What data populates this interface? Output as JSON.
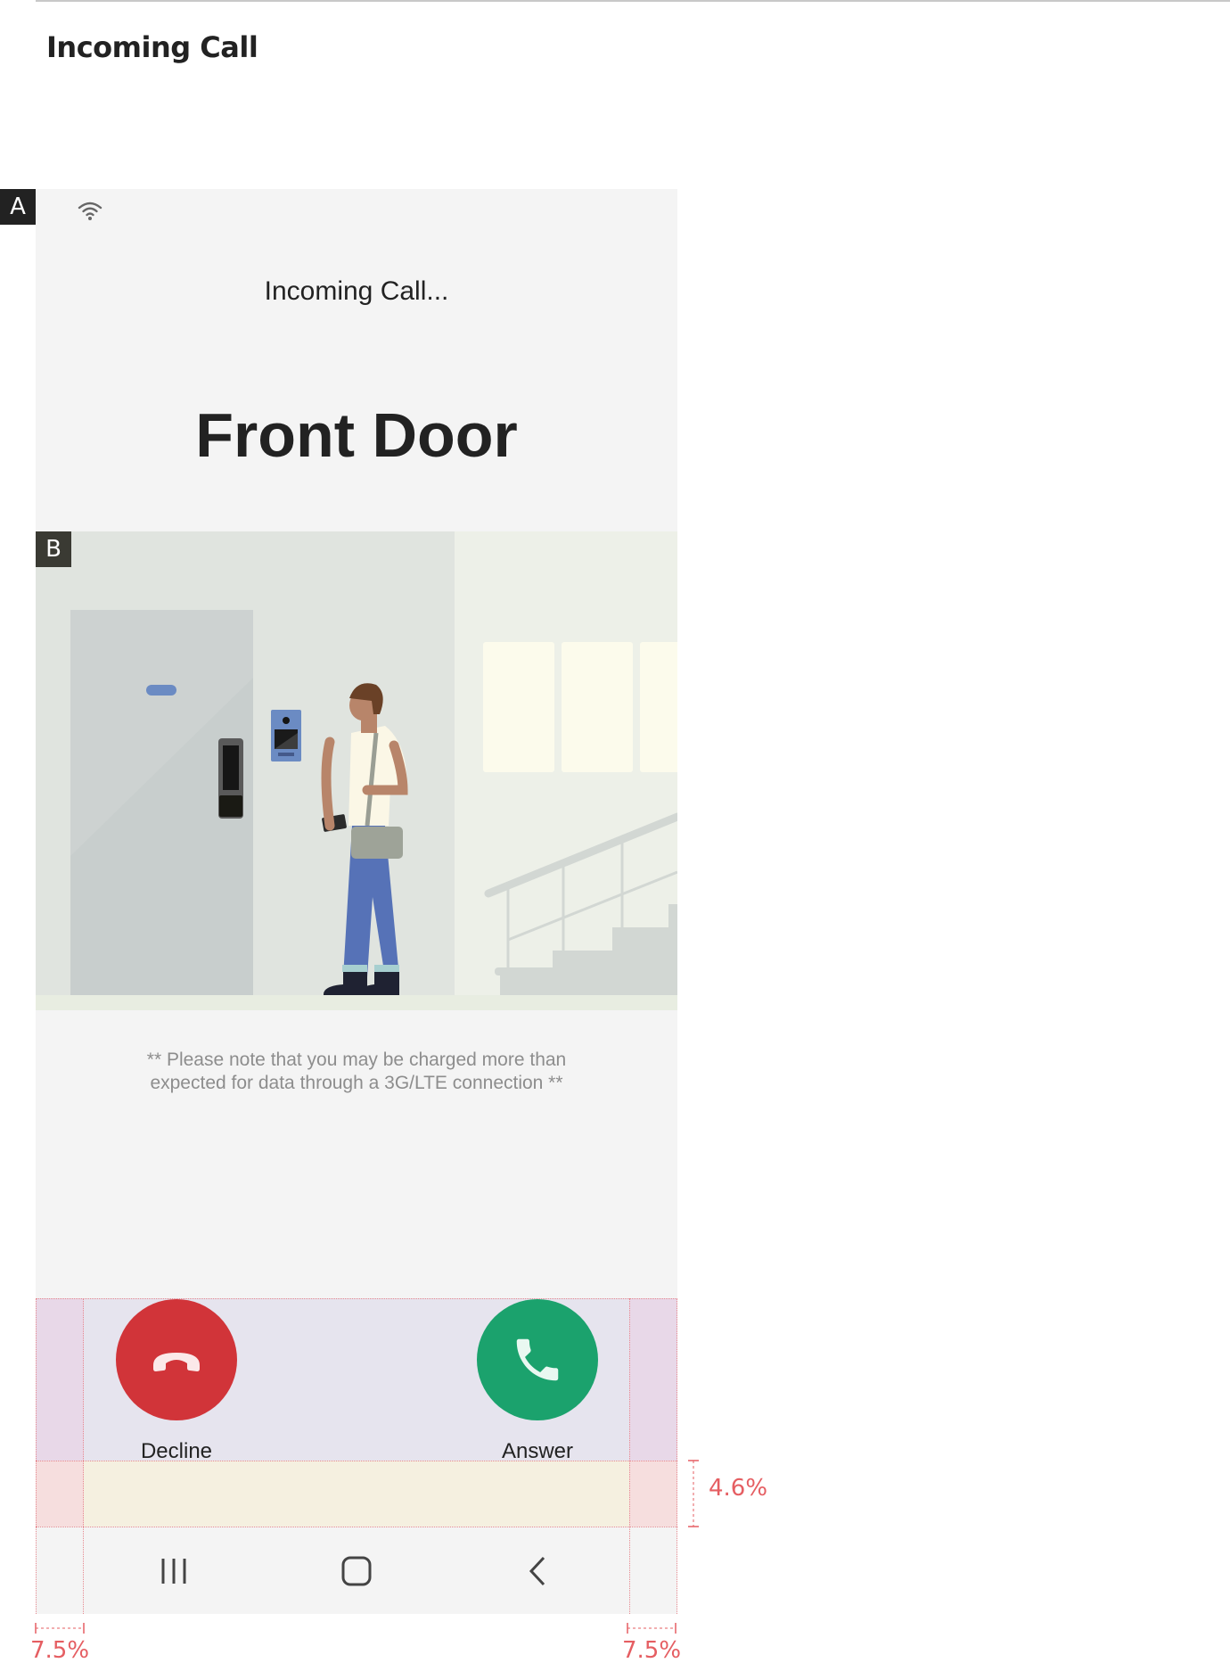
{
  "page": {
    "heading": "Incoming Call"
  },
  "tags": {
    "a": "A",
    "b": "B"
  },
  "call": {
    "status": "Incoming Call...",
    "caller": "Front Door",
    "notice_line1": "** Please note that you may be charged more than",
    "notice_line2": "expected for data through a 3G/LTE connection **"
  },
  "actions": {
    "decline_label": "Decline",
    "answer_label": "Answer"
  },
  "colors": {
    "decline": "#d13439",
    "answer": "#1ba26d",
    "guide": "#e55e62"
  },
  "icons": {
    "status": "wifi-icon",
    "decline": "phone-hangup-icon",
    "answer": "phone-icon",
    "nav_recents": "recents-icon",
    "nav_home": "home-icon",
    "nav_back": "back-icon"
  },
  "annotations": {
    "gap_percent": "4.6%",
    "left_margin": "7.5%",
    "right_margin": "7.5%"
  }
}
